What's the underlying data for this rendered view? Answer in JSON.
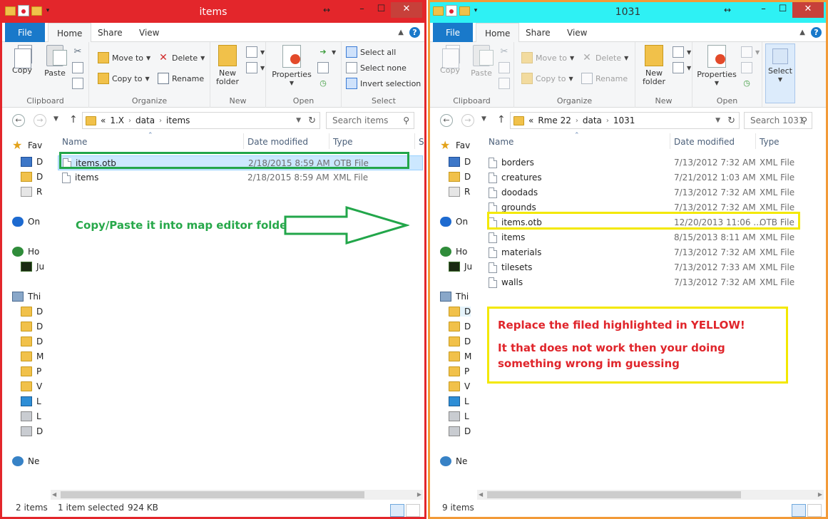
{
  "left": {
    "title": "items",
    "tabs": {
      "file": "File",
      "home": "Home",
      "share": "Share",
      "view": "View"
    },
    "ribbon": {
      "clipboard": {
        "copy": "Copy",
        "paste": "Paste",
        "label": "Clipboard"
      },
      "organize": {
        "move_to": "Move to",
        "copy_to": "Copy to",
        "delete": "Delete",
        "rename": "Rename",
        "label": "Organize"
      },
      "new": {
        "new_folder_line1": "New",
        "new_folder_line2": "folder",
        "label": "New"
      },
      "open": {
        "properties": "Properties",
        "label": "Open"
      },
      "select": {
        "select_all": "Select all",
        "select_none": "Select none",
        "invert": "Invert selection",
        "label": "Select"
      }
    },
    "address": {
      "overflow": "«",
      "crumbs": [
        "1.X",
        "data",
        "items"
      ],
      "search_placeholder": "Search items"
    },
    "nav": [
      "Fav",
      "D",
      "D",
      "R",
      "On",
      "Ho",
      "Ju",
      "Thi",
      "D",
      "D",
      "D",
      "M",
      "P",
      "V",
      "L",
      "L",
      "D",
      "Ne"
    ],
    "columns": {
      "name": "Name",
      "date": "Date modified",
      "type": "Type",
      "size": "S"
    },
    "files": [
      {
        "name": "items.otb",
        "date": "2/18/2015 8:59 AM",
        "type": "OTB File"
      },
      {
        "name": "items",
        "date": "2/18/2015 8:59 AM",
        "type": "XML File"
      }
    ],
    "annotation": "Copy/Paste it into map editor folder-",
    "status": {
      "count": "2 items",
      "selected": "1 item selected",
      "size": "924 KB"
    }
  },
  "right": {
    "title": "1031",
    "tabs": {
      "file": "File",
      "home": "Home",
      "share": "Share",
      "view": "View"
    },
    "ribbon": {
      "clipboard": {
        "copy": "Copy",
        "paste": "Paste",
        "label": "Clipboard"
      },
      "organize": {
        "move_to": "Move to",
        "copy_to": "Copy to",
        "delete": "Delete",
        "rename": "Rename",
        "label": "Organize"
      },
      "new": {
        "new_folder_line1": "New",
        "new_folder_line2": "folder",
        "label": "New"
      },
      "open": {
        "properties": "Properties",
        "label": "Open"
      },
      "select": {
        "select": "Select"
      }
    },
    "address": {
      "overflow": "«",
      "crumbs": [
        "Rme 22",
        "data",
        "1031"
      ],
      "search_placeholder": "Search 1031"
    },
    "nav": [
      "Fav",
      "D",
      "D",
      "R",
      "On",
      "Ho",
      "Ju",
      "Thi",
      "D",
      "D",
      "D",
      "M",
      "P",
      "V",
      "L",
      "L",
      "D",
      "Ne"
    ],
    "columns": {
      "name": "Name",
      "date": "Date modified",
      "type": "Type"
    },
    "files": [
      {
        "name": "borders",
        "date": "7/13/2012 7:32 AM",
        "type": "XML File"
      },
      {
        "name": "creatures",
        "date": "7/21/2012 1:03 AM",
        "type": "XML File"
      },
      {
        "name": "doodads",
        "date": "7/13/2012 7:32 AM",
        "type": "XML File"
      },
      {
        "name": "grounds",
        "date": "7/13/2012 7:32 AM",
        "type": "XML File"
      },
      {
        "name": "items.otb",
        "date": "12/20/2013 11:06 ...",
        "type": "OTB File"
      },
      {
        "name": "items",
        "date": "8/15/2013 8:11 AM",
        "type": "XML File"
      },
      {
        "name": "materials",
        "date": "7/13/2012 7:32 AM",
        "type": "XML File"
      },
      {
        "name": "tilesets",
        "date": "7/13/2012 7:33 AM",
        "type": "XML File"
      },
      {
        "name": "walls",
        "date": "7/13/2012 7:32 AM",
        "type": "XML File"
      }
    ],
    "note": {
      "line1": "Replace the filed highlighted in YELLOW!",
      "line2": "It that does not work then your doing something wrong im guessing"
    },
    "status": {
      "count": "9 items"
    }
  },
  "colors": {
    "left_border": "#e3262b",
    "right_border": "#f29a38",
    "right_titlebar": "#2ef1f4",
    "green_annotation": "#27a84a",
    "yellow_highlight": "#f3e800",
    "red_text": "#e0252b"
  }
}
